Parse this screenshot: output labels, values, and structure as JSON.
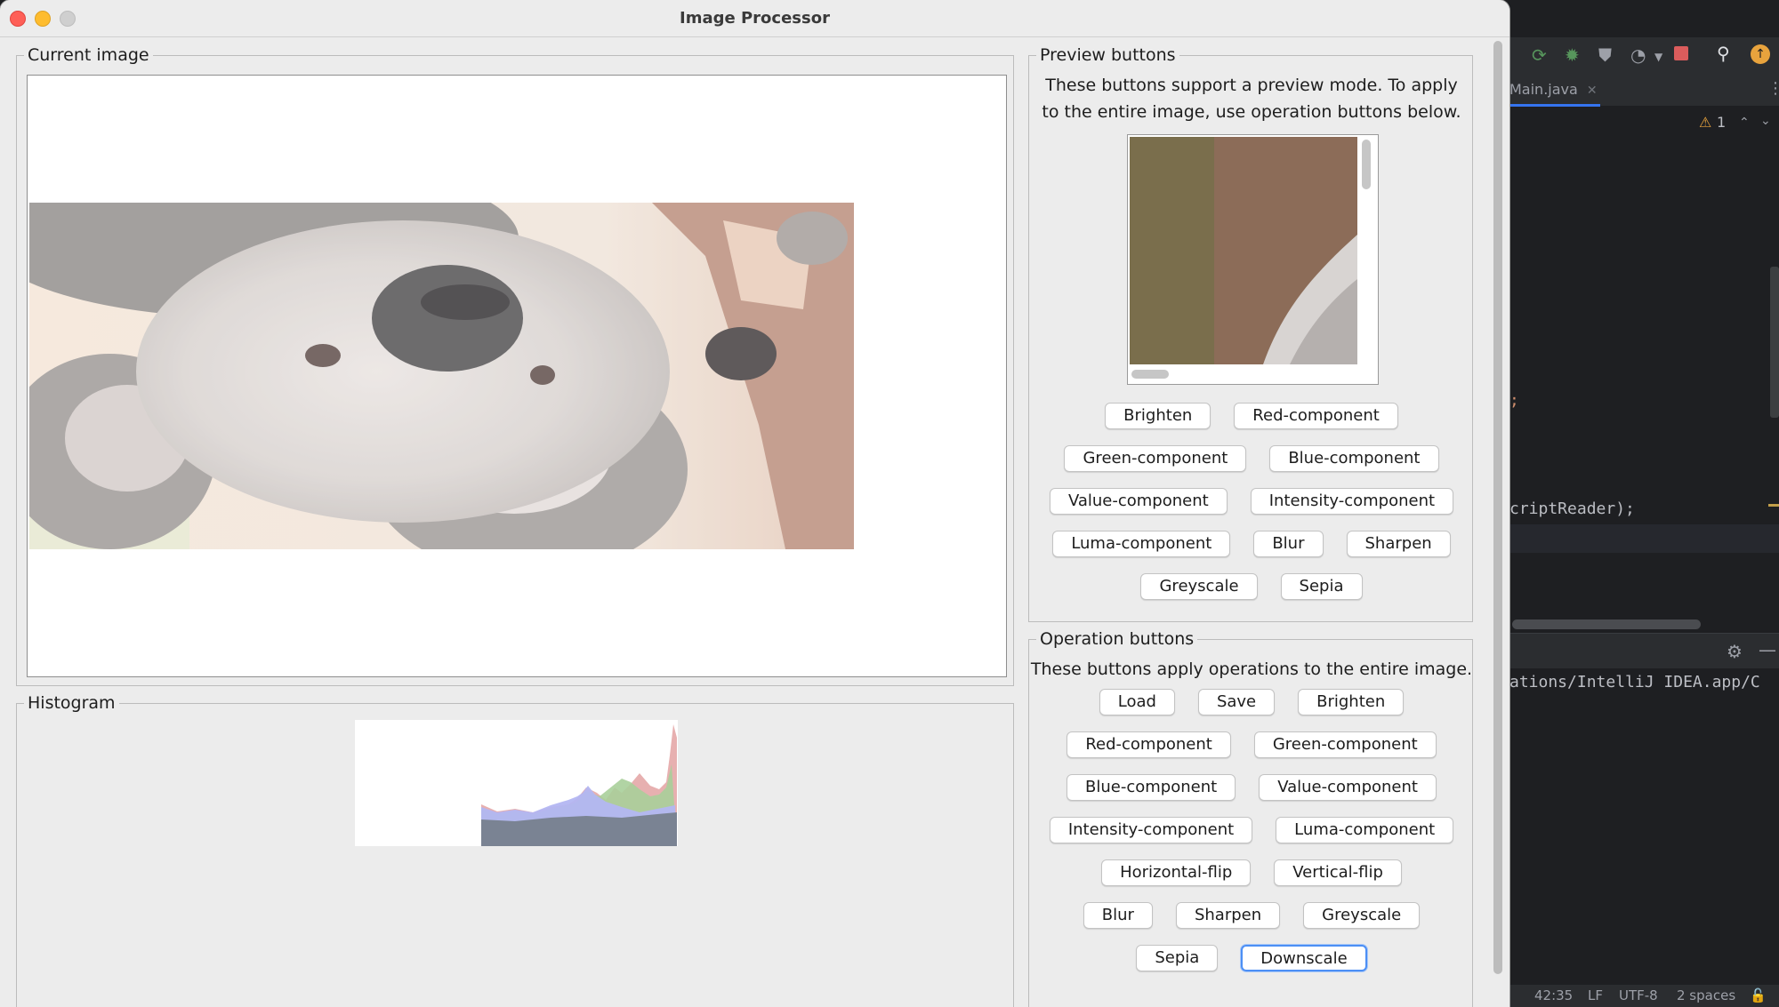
{
  "window": {
    "title": "Image Processor"
  },
  "current_image": {
    "title": "Current image",
    "image_alt": "koala photo (brightened, flipped upside down)"
  },
  "histogram": {
    "title": "Histogram"
  },
  "preview": {
    "title": "Preview buttons",
    "description_line1": "These buttons support a preview mode. To apply",
    "description_line2": "to the entire image, use operation buttons below.",
    "buttons": [
      "Brighten",
      "Red-component",
      "Green-component",
      "Blue-component",
      "Value-component",
      "Intensity-component",
      "Luma-component",
      "Blur",
      "Sharpen",
      "Greyscale",
      "Sepia"
    ]
  },
  "operations": {
    "title": "Operation buttons",
    "description": "These buttons apply operations to the entire image.",
    "buttons": [
      "Load",
      "Save",
      "Brighten",
      "Red-component",
      "Green-component",
      "Blue-component",
      "Value-component",
      "Intensity-component",
      "Luma-component",
      "Horizontal-flip",
      "Vertical-flip",
      "Blur",
      "Sharpen",
      "Greyscale",
      "Sepia",
      "Downscale"
    ],
    "focused_button": "Downscale"
  },
  "ide": {
    "tab_label": "Main.java",
    "tab_close": "✕",
    "warning_count": "1",
    "code_line_semicolon": ";",
    "code_line_reader": "criptReader);",
    "run_output": "ations/IntelliJ IDEA.app/C",
    "status": {
      "position": "42:35",
      "line_sep": "LF",
      "encoding": "UTF-8",
      "indent": "2 spaces"
    }
  },
  "colors": {
    "ide_bg": "#1e1f22",
    "window_bg": "#ececec",
    "focus_ring": "#4c8ff5",
    "traffic_close": "#fe5f57",
    "traffic_min": "#febc2e"
  }
}
